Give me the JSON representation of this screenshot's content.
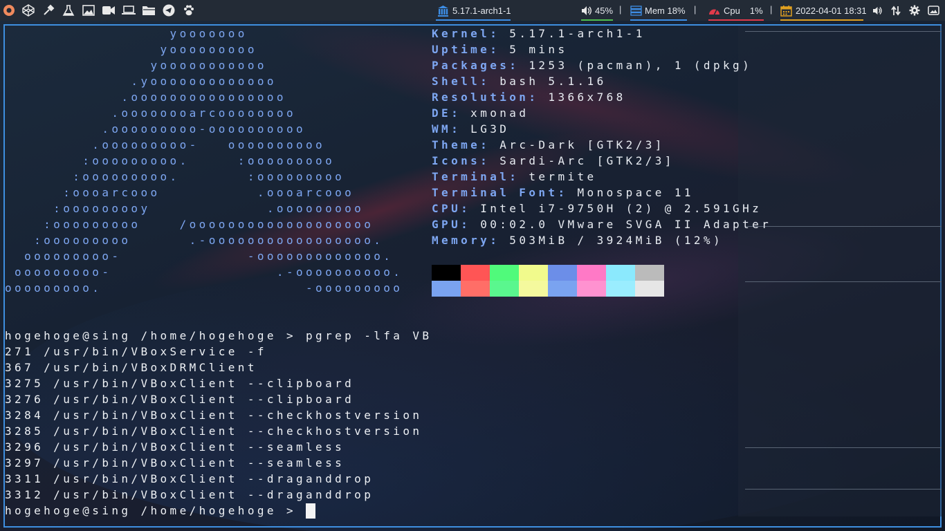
{
  "topbar": {
    "left_icons": [
      "app-menu-icon",
      "codepen-icon",
      "color-picker-icon",
      "flask-icon",
      "image-icon",
      "video-icon",
      "laptop-icon",
      "folder-icon",
      "telegram-icon",
      "paw-icon"
    ],
    "kernel_label": "5.17.1-arch1-1",
    "volume_label": "45%",
    "mem_label": "Mem 18%",
    "cpu_label": "Cpu",
    "cpu_value": "1%",
    "datetime_label": "2022-04-01 18:31",
    "separator": "|",
    "right_icons": [
      "speaker-icon",
      "network-icon",
      "settings-icon",
      "screenshot-icon"
    ],
    "colors": {
      "bar_bg": "#232b36",
      "kernel": "#3d8ee6",
      "volume": "#4fbf4f",
      "mem": "#3d8ee6",
      "cpu": "#e03a4a",
      "date": "#e0a020"
    }
  },
  "neofetch": {
    "art": [
      "                 yooooooo",
      "                yooooooooo",
      "               yooooooooooo",
      "             .yooooooooooooo",
      "            .oooooooooooooooo",
      "           .oooooooarcoooooooo",
      "          .ooooooooo-oooooooooo",
      "         .ooooooooo-   oooooooooo",
      "        :ooooooooo.     :ooooooooo",
      "       :ooooooooo.       :ooooooooo",
      "      :oooarcooo          .oooarcooo",
      "     :ooooooooy            .ooooooooo",
      "    :ooooooooo    /ooooooooooooooooooo",
      "   :ooooooooo      .-ooooooooooooooooo.",
      "  ooooooooo-             -ooooooooooooo.",
      " ooooooooo-                 .-oooooooooo.",
      "ooooooooo.                     -ooooooooo"
    ],
    "info": [
      {
        "key": "Kernel",
        "value": "5.17.1-arch1-1"
      },
      {
        "key": "Uptime",
        "value": "5 mins"
      },
      {
        "key": "Packages",
        "value": "1253 (pacman), 1 (dpkg)"
      },
      {
        "key": "Shell",
        "value": "bash 5.1.16"
      },
      {
        "key": "Resolution",
        "value": "1366x768"
      },
      {
        "key": "DE",
        "value": "xmonad"
      },
      {
        "key": "WM",
        "value": "LG3D"
      },
      {
        "key": "Theme",
        "value": "Arc-Dark [GTK2/3]"
      },
      {
        "key": "Icons",
        "value": "Sardi-Arc [GTK2/3]"
      },
      {
        "key": "Terminal",
        "value": "termite"
      },
      {
        "key": "Terminal Font",
        "value": "Monospace 11"
      },
      {
        "key": "CPU",
        "value": "Intel i7-9750H (2) @ 2.591GHz"
      },
      {
        "key": "GPU",
        "value": "00:02.0 VMware SVGA II Adapter"
      },
      {
        "key": "Memory",
        "value": "503MiB / 3924MiB (12%)"
      }
    ],
    "palette_top": [
      "#000000",
      "#ff5555",
      "#50fa7b",
      "#f1fa8c",
      "#6c8ee8",
      "#ff79c6",
      "#8be9fd",
      "#bbbbbb"
    ],
    "palette_bottom": [
      "#7aa3f0",
      "#ff6e67",
      "#5af78e",
      "#f4f99d",
      "#7aa3f0",
      "#ff92d0",
      "#9aedfe",
      "#e6e6e6"
    ]
  },
  "terminal": {
    "command_line": "hogehoge@sing /home/hogehoge > pgrep -lfa VB",
    "output": [
      "271 /usr/bin/VBoxService -f",
      "367 /usr/bin/VBoxDRMClient",
      "3275 /usr/bin/VBoxClient --clipboard",
      "3276 /usr/bin/VBoxClient --clipboard",
      "3284 /usr/bin/VBoxClient --checkhostversion",
      "3285 /usr/bin/VBoxClient --checkhostversion",
      "3296 /usr/bin/VBoxClient --seamless",
      "3297 /usr/bin/VBoxClient --seamless",
      "3311 /usr/bin/VBoxClient --draganddrop",
      "3312 /usr/bin/VBoxClient --draganddrop"
    ],
    "prompt": "hogehoge@sing /home/hogehoge > "
  }
}
